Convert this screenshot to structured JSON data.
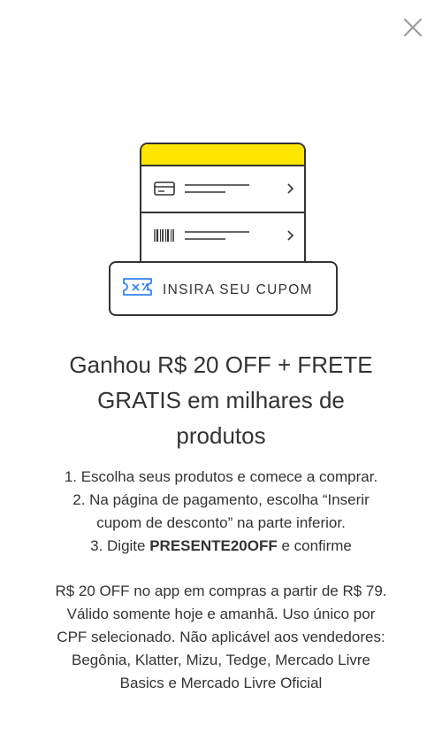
{
  "close_label": "×",
  "illustration": {
    "coupon_label": "INSIRA SEU CUPOM",
    "accent_color": "#FFE600",
    "coupon_icon_color": "#3483FA",
    "rows": [
      {
        "icon": "credit-card-icon"
      },
      {
        "icon": "barcode-icon"
      }
    ]
  },
  "title_lines": [
    "Ganhou R$ 20 OFF + FRETE",
    "GRATIS em milhares de",
    "produtos"
  ],
  "steps": {
    "line1": "1. Escolha seus produtos e comece a comprar.",
    "line2": "2. Na página de pagamento, escolha “Inserir",
    "line3": "cupom de desconto” na parte inferior.",
    "line4_prefix": "3. Digite ",
    "line4_code": "PRESENTE20OFF",
    "line4_suffix": " e confirme"
  },
  "terms_lines": [
    "R$ 20 OFF no app em compras a partir de R$ 79.",
    "Válido somente hoje e amanhã. Uso único por",
    "CPF selecionado. Não aplicável aos vendedores:",
    "Begônia, Klatter, Mizu, Tedge, Mercado Livre",
    "Basics e Mercado Livre Oficial"
  ]
}
